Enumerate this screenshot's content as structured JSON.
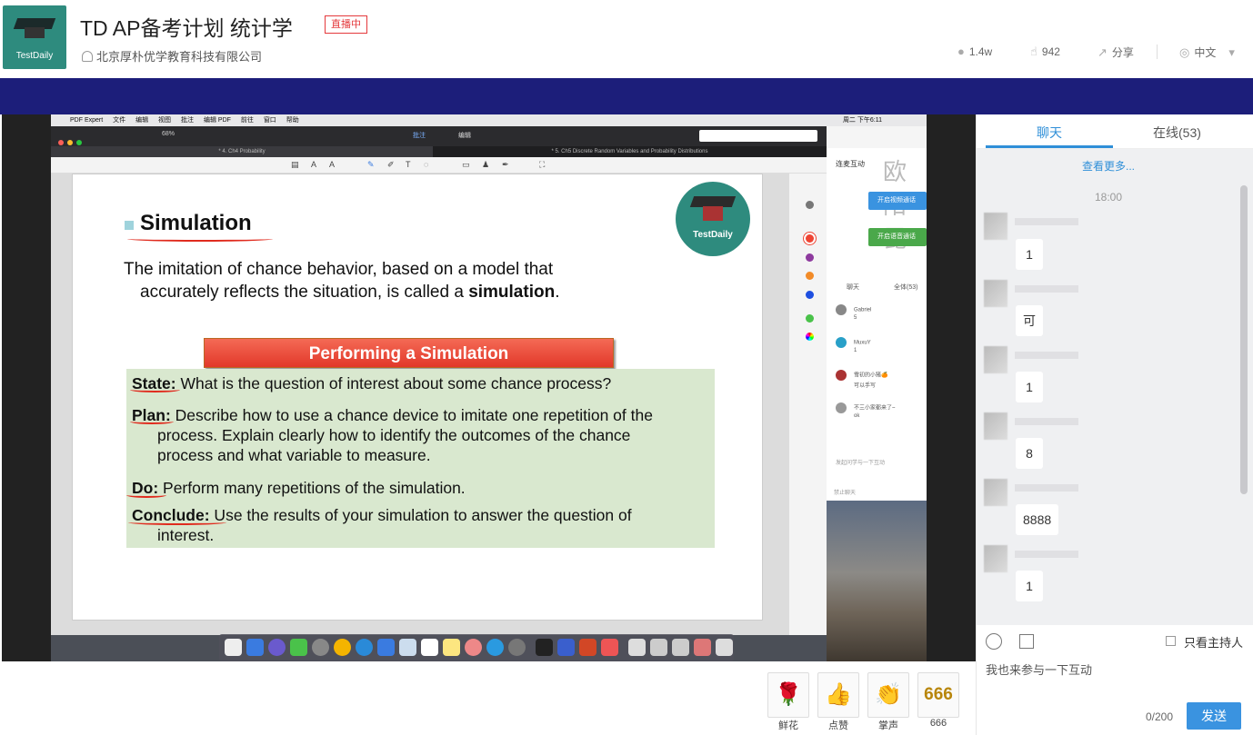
{
  "header": {
    "logo_label": "TestDaily",
    "title": "TD AP备考计划 统计学",
    "live_badge": "直播中",
    "company": "北京厚朴优学教育科技有限公司",
    "views": "1.4w",
    "likes": "942",
    "share": "分享",
    "language": "中文"
  },
  "mac": {
    "menubar": [
      "PDF Expert",
      "文件",
      "编辑",
      "视图",
      "批注",
      "编辑 PDF",
      "前往",
      "窗口",
      "帮助"
    ],
    "menubar_right": "周二 下午6:11",
    "zoom": "68%",
    "annotate_label": "批注",
    "edit_label": "编辑",
    "tab1": "* 4. Ch4 Probability",
    "tab2": "* 5. Ch5 Discrete Random Variables and Probability Distributions"
  },
  "slide": {
    "logo_label": "TestDaily",
    "title": "Simulation",
    "definition_line1": "The imitation of chance behavior, based on a model that",
    "definition_line2_a": "accurately reflects the situation, is called a ",
    "definition_line2_b": "simulation",
    "definition_line2_c": ".",
    "banner": "Performing a Simulation",
    "state_label": "State:",
    "state_text": " What is the question of interest about some chance process?",
    "plan_label": "Plan:",
    "plan_text1": " Describe how to use a chance device to imitate one repetition of the",
    "plan_text2": "process. Explain clearly how to identify the outcomes of the chance",
    "plan_text3": "process and what variable to measure.",
    "do_label": "Do:",
    "do_text": " Perform many repetitions of the simulation.",
    "conclude_label": "Conclude:",
    "conclude_text1": " Use the results of your simulation to answer the question of",
    "conclude_text2": "interest."
  },
  "mac_chat": {
    "section": "连麦互动",
    "watermark": "欧阳昆",
    "video_btn": "开启视频通话",
    "audio_btn": "开启语音通话",
    "tab_chat": "聊天",
    "tab_online": "全体(53)",
    "messages": [
      {
        "name": "Gabriel",
        "text": "5"
      },
      {
        "name": "MuxuY",
        "text": "1"
      },
      {
        "name": "雪初的小猪🍊",
        "text": "可以手写"
      },
      {
        "name": "不三小家都来了~",
        "text": "ok"
      }
    ],
    "hint": "发起问学与一下互动",
    "toggle": "禁止聊天"
  },
  "chat": {
    "tab_chat": "聊天",
    "tab_online": "在线(53)",
    "see_more": "查看更多...",
    "time": "18:00",
    "messages": [
      "1",
      "可",
      "1",
      "8",
      "8888",
      "1"
    ],
    "only_host": "只看主持人",
    "placeholder": "我也来参与一下互动",
    "count": "0/200",
    "send": "发送"
  },
  "gifts": [
    {
      "icon": "rose-icon",
      "glyph": "🌹",
      "label": "鲜花"
    },
    {
      "icon": "like-icon",
      "glyph": "👍",
      "label": "点赞"
    },
    {
      "icon": "clap-icon",
      "glyph": "👏",
      "label": "掌声"
    },
    {
      "icon": "666-icon",
      "glyph": "666",
      "label": "666"
    }
  ],
  "colors": {
    "accent": "#2f8fd8",
    "band": "#1c1e7a",
    "live": "#e4393c",
    "brand": "#2e8b7e"
  }
}
